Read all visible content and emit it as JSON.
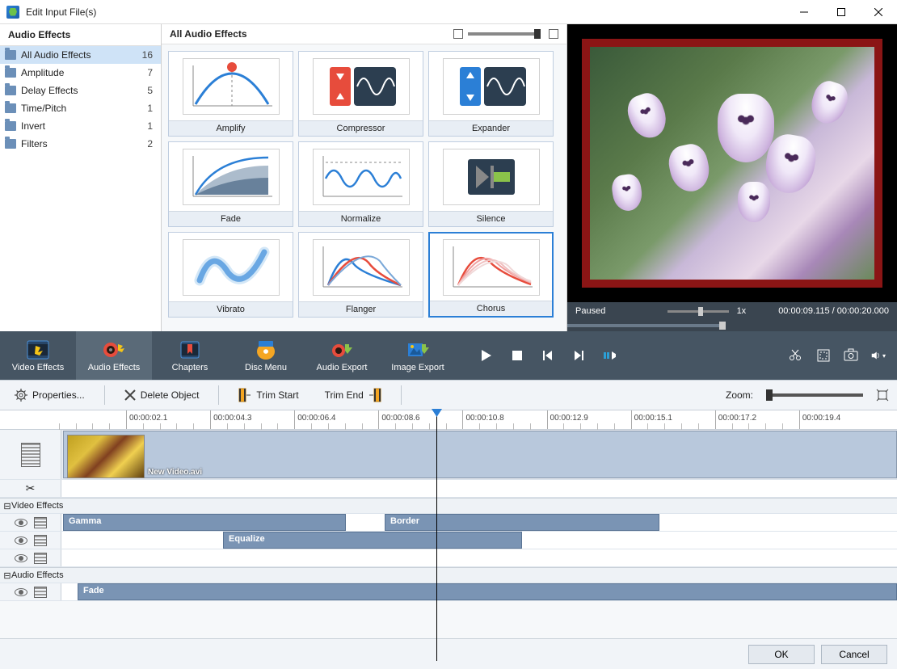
{
  "window": {
    "title": "Edit Input File(s)"
  },
  "sidebar": {
    "header": "Audio Effects",
    "items": [
      {
        "label": "All Audio Effects",
        "count": "16",
        "selected": true
      },
      {
        "label": "Amplitude",
        "count": "7"
      },
      {
        "label": "Delay Effects",
        "count": "5"
      },
      {
        "label": "Time/Pitch",
        "count": "1"
      },
      {
        "label": "Invert",
        "count": "1"
      },
      {
        "label": "Filters",
        "count": "2"
      }
    ]
  },
  "effects": {
    "header": "All Audio Effects",
    "items": [
      {
        "label": "Amplify"
      },
      {
        "label": "Compressor"
      },
      {
        "label": "Expander"
      },
      {
        "label": "Fade"
      },
      {
        "label": "Normalize"
      },
      {
        "label": "Silence"
      },
      {
        "label": "Vibrato"
      },
      {
        "label": "Flanger"
      },
      {
        "label": "Chorus",
        "selected": true
      }
    ]
  },
  "preview": {
    "status": "Paused",
    "speed": "1x",
    "time": "00:00:09.115 / 00:00:20.000"
  },
  "tabs": {
    "items": [
      {
        "label": "Video Effects"
      },
      {
        "label": "Audio Effects",
        "active": true
      },
      {
        "label": "Chapters"
      },
      {
        "label": "Disc Menu"
      },
      {
        "label": "Audio Export"
      },
      {
        "label": "Image Export"
      }
    ]
  },
  "secondary": {
    "properties": "Properties...",
    "delete": "Delete Object",
    "trimStart": "Trim Start",
    "trimEnd": "Trim End",
    "zoom": "Zoom:"
  },
  "ruler": {
    "ticks": [
      "00:00:02.1",
      "00:00:04.3",
      "00:00:06.4",
      "00:00:08.6",
      "00:00:10.8",
      "00:00:12.9",
      "00:00:15.1",
      "00:00:17.2",
      "00:00:19.4"
    ]
  },
  "timeline": {
    "videoClip": "New Video.avi",
    "groupVideo": "Video Effects",
    "groupAudio": "Audio Effects",
    "fx": {
      "gamma": "Gamma",
      "border": "Border",
      "equalize": "Equalize",
      "fade": "Fade"
    }
  },
  "buttons": {
    "ok": "OK",
    "cancel": "Cancel"
  }
}
